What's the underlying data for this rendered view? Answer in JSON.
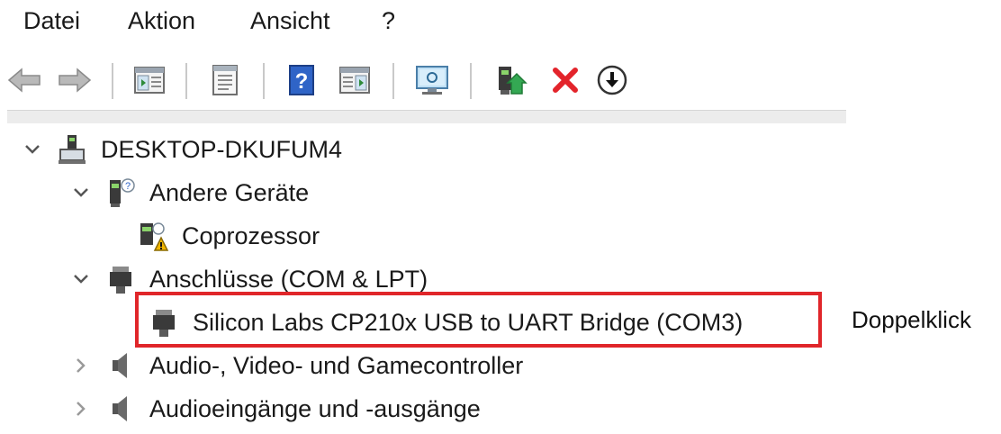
{
  "menu": {
    "items": [
      "Datei",
      "Aktion",
      "Ansicht",
      "?"
    ]
  },
  "toolbar": {
    "buttons": [
      "back-arrow-icon",
      "forward-arrow-icon",
      "properties-panel-icon",
      "document-icon",
      "help-icon",
      "action-panel-icon",
      "monitor-icon",
      "update-driver-icon",
      "uninstall-x-icon",
      "download-circle-icon"
    ]
  },
  "tree": {
    "root": "DESKTOP-DKUFUM4",
    "nodes": [
      {
        "label": "Andere Geräte",
        "expanded": true
      },
      {
        "label": "Coprozessor",
        "warning": true
      },
      {
        "label": "Anschlüsse (COM & LPT)",
        "expanded": true
      },
      {
        "label": "Silicon Labs CP210x USB to UART Bridge (COM3)",
        "highlighted": true
      },
      {
        "label": "Audio-, Video- und Gamecontroller",
        "expanded": false
      },
      {
        "label": "Audioeingänge und -ausgänge",
        "expanded": false
      }
    ]
  },
  "callout": {
    "text": "Doppelklick"
  },
  "colors": {
    "highlight": "#e0262a",
    "uninstall": "#e3242b",
    "help_blue": "#2f64c7"
  }
}
